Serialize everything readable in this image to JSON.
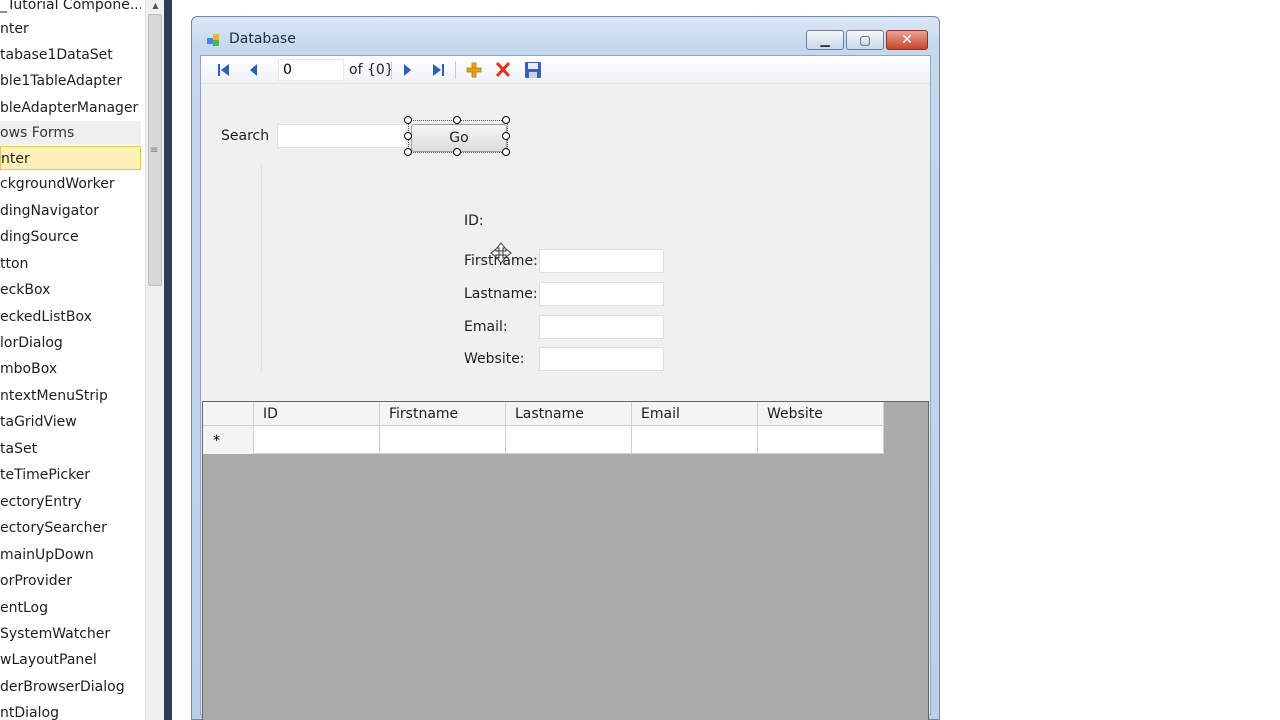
{
  "toolbox": {
    "items": [
      {
        "label": "_Tutorial Compone..."
      },
      {
        "label": "nter"
      },
      {
        "label": "tabase1DataSet"
      },
      {
        "label": "ble1TableAdapter"
      },
      {
        "label": "bleAdapterManager"
      },
      {
        "label": "ows Forms"
      },
      {
        "label": "nter"
      },
      {
        "label": "ckgroundWorker"
      },
      {
        "label": "dingNavigator"
      },
      {
        "label": "dingSource"
      },
      {
        "label": "tton"
      },
      {
        "label": "eckBox"
      },
      {
        "label": "eckedListBox"
      },
      {
        "label": "lorDialog"
      },
      {
        "label": "mboBox"
      },
      {
        "label": "ntextMenuStrip"
      },
      {
        "label": "taGridView"
      },
      {
        "label": "taSet"
      },
      {
        "label": "teTimePicker"
      },
      {
        "label": "ectoryEntry"
      },
      {
        "label": "ectorySearcher"
      },
      {
        "label": "mainUpDown"
      },
      {
        "label": "orProvider"
      },
      {
        "label": "entLog"
      },
      {
        "label": "SystemWatcher"
      },
      {
        "label": "wLayoutPanel"
      },
      {
        "label": "derBrowserDialog"
      },
      {
        "label": "ntDialog"
      }
    ],
    "header_index": 5,
    "selected_index": 6,
    "scroll_grip": "≡"
  },
  "window": {
    "title": "Database",
    "min_glyph": "▁",
    "max_glyph": "▢",
    "close_glyph": "✕",
    "colors": {
      "close": "#c7452a",
      "frame": "#bcd0ea"
    }
  },
  "navigator": {
    "position_value": "0",
    "count_text": "of {0}",
    "icons": [
      "move-first-icon",
      "move-previous-icon",
      "move-next-icon",
      "move-last-icon",
      "add-new-icon",
      "delete-icon",
      "save-icon"
    ]
  },
  "search": {
    "label": "Search",
    "value": "",
    "go_label": "Go"
  },
  "details": {
    "id_label": "ID:",
    "firstname_label": "Firstname:",
    "lastname_label": "Lastname:",
    "email_label": "Email:",
    "website_label": "Website:"
  },
  "grid": {
    "columns": [
      "ID",
      "Firstname",
      "Lastname",
      "Email",
      "Website"
    ],
    "new_row_marker": "*"
  }
}
